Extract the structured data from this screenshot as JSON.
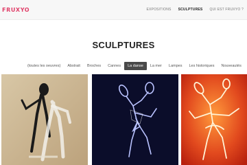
{
  "header": {
    "logo": "FRUXYO",
    "nav": [
      "EXPOSITIONS",
      "SCULPTURES",
      "QUI EST FRUXYO ?"
    ],
    "nav_active": "SCULPTURES"
  },
  "page": {
    "title": "SCULPTURES"
  },
  "filters": {
    "items": [
      "(toutes les oeuvres)",
      "Abstrait",
      "Broches",
      "Cannes",
      "La danse",
      "La mer",
      "Lampes",
      "Les historiques",
      "Nouveautés"
    ],
    "active": "La danse"
  },
  "colors": {
    "brand": "#e0406a",
    "active_filter_bg": "#4a4a4a"
  }
}
